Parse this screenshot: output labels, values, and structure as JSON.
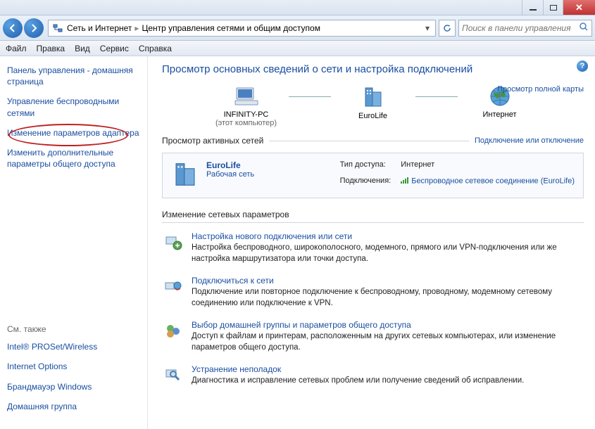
{
  "window": {
    "search_placeholder": "Поиск в панели управления"
  },
  "breadcrumb": {
    "l1": "Сеть и Интернет",
    "l2": "Центр управления сетями и общим доступом"
  },
  "menu": {
    "file": "Файл",
    "edit": "Правка",
    "view": "Вид",
    "service": "Сервис",
    "help": "Справка"
  },
  "sidebar": {
    "home": "Панель управления - домашняя страница",
    "wireless": "Управление беспроводными сетями",
    "adapter": "Изменение параметров адаптера",
    "sharing": "Изменить дополнительные параметры общего доступа",
    "seealso": "См. также",
    "intel": "Intel® PROSet/Wireless",
    "inetopt": "Internet Options",
    "firewall": "Брандмауэр Windows",
    "homegroup": "Домашняя группа"
  },
  "main": {
    "heading": "Просмотр основных сведений о сети и настройка подключений",
    "fullmap": "Просмотр полной карты",
    "nodes": {
      "pc": "INFINITY-PC",
      "pc_sub": "(этот компьютер)",
      "mid": "EuroLife",
      "net": "Интернет"
    },
    "active_label": "Просмотр активных сетей",
    "active_link": "Подключение или отключение",
    "active": {
      "name": "EuroLife",
      "type": "Рабочая сеть",
      "k1": "Тип доступа:",
      "v1": "Интернет",
      "k2": "Подключения:",
      "v2": "Беспроводное сетевое соединение (EuroLife)"
    },
    "params_heading": "Изменение сетевых параметров",
    "tasks": [
      {
        "title": "Настройка нового подключения или сети",
        "desc": "Настройка беспроводного, широкополосного, модемного, прямого или VPN-подключения или же настройка маршрутизатора или точки доступа."
      },
      {
        "title": "Подключиться к сети",
        "desc": "Подключение или повторное подключение к беспроводному, проводному, модемному сетевому соединению или подключение к VPN."
      },
      {
        "title": "Выбор домашней группы и параметров общего доступа",
        "desc": "Доступ к файлам и принтерам, расположенным на других сетевых компьютерах, или изменение параметров общего доступа."
      },
      {
        "title": "Устранение неполадок",
        "desc": "Диагностика и исправление сетевых проблем или получение сведений об исправлении."
      }
    ]
  }
}
